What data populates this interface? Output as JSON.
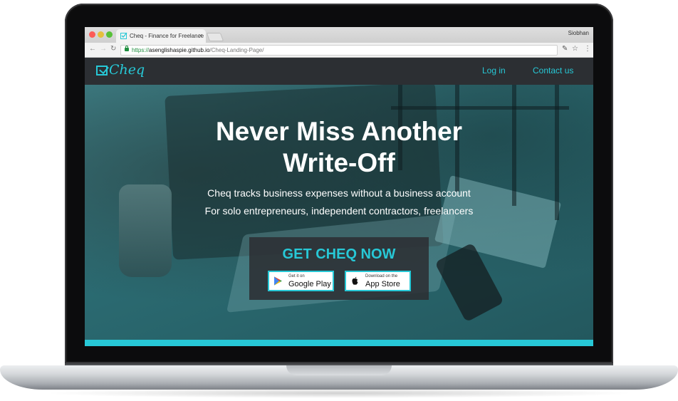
{
  "browser": {
    "tab_title": "Cheq - Finance for Freelance",
    "tab_close": "×",
    "profile_name": "Siobhan",
    "url_scheme": "https://",
    "url_host": "asenglishaspie.github.io",
    "url_path": "/Cheq-Landing-Page/",
    "icons": [
      "back-arrow-icon",
      "forward-arrow-icon",
      "reload-icon",
      "lock-icon",
      "extension-icon",
      "star-icon",
      "menu-icon"
    ]
  },
  "site": {
    "logo_text": "Cheq",
    "nav": {
      "login": "Log in",
      "contact": "Contact us"
    },
    "accent_color": "#27c8d6",
    "nav_background": "#2c2f33"
  },
  "hero": {
    "title_line1": "Never Miss Another",
    "title_line2": "Write-Off",
    "subtitle1": "Cheq tracks business expenses without a business account",
    "subtitle2": "For solo entrepreneurs, independent contractors, freelancers",
    "cta_title": "GET CHEQ NOW",
    "google_small": "Get it on",
    "google_big": "Google Play",
    "apple_small": "Download on the",
    "apple_big": "App Store"
  }
}
